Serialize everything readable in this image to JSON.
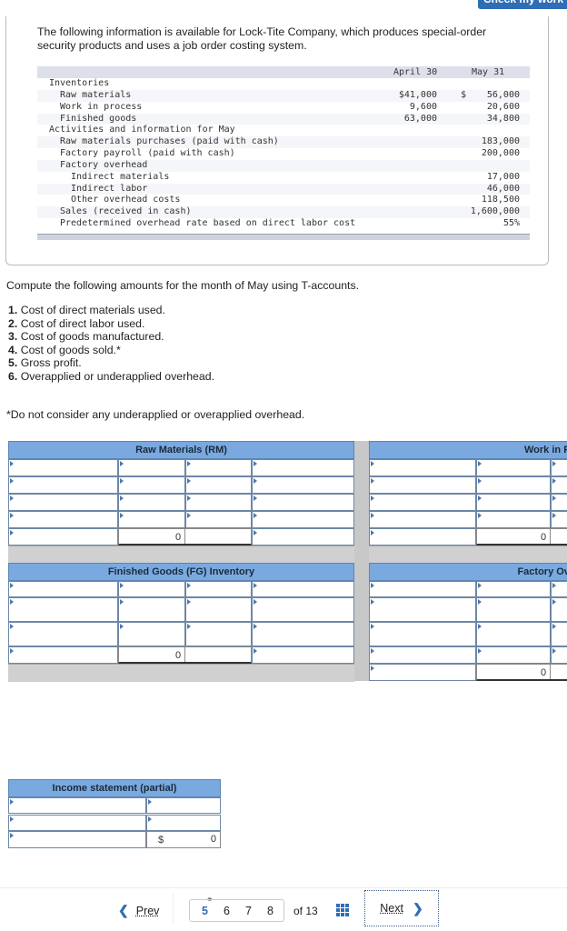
{
  "header": {
    "check_button_label": "Check my work"
  },
  "intro": "The following information is available for Lock-Tite Company, which produces special-order security products and uses a job order costing system.",
  "data_table": {
    "col_headers": [
      "April 30",
      "May 31"
    ],
    "rows": [
      {
        "label": "Inventories",
        "indent": 0,
        "april": "",
        "may_sym": "",
        "may": ""
      },
      {
        "label": "Raw materials",
        "indent": 1,
        "april": "$41,000",
        "may_sym": "$",
        "may": "56,000"
      },
      {
        "label": "Work in process",
        "indent": 1,
        "april": "9,600",
        "may_sym": "",
        "may": "20,600"
      },
      {
        "label": "Finished goods",
        "indent": 1,
        "april": "63,000",
        "may_sym": "",
        "may": "34,800"
      },
      {
        "label": "Activities and information for May",
        "indent": 0,
        "april": "",
        "may_sym": "",
        "may": ""
      },
      {
        "label": "Raw materials purchases (paid with cash)",
        "indent": 1,
        "april": "",
        "may_sym": "",
        "may": "183,000"
      },
      {
        "label": "Factory payroll (paid with cash)",
        "indent": 1,
        "april": "",
        "may_sym": "",
        "may": "200,000"
      },
      {
        "label": "Factory overhead",
        "indent": 1,
        "april": "",
        "may_sym": "",
        "may": ""
      },
      {
        "label": "Indirect materials",
        "indent": 2,
        "april": "",
        "may_sym": "",
        "may": "17,000"
      },
      {
        "label": "Indirect labor",
        "indent": 2,
        "april": "",
        "may_sym": "",
        "may": "46,000"
      },
      {
        "label": "Other overhead costs",
        "indent": 2,
        "april": "",
        "may_sym": "",
        "may": "118,500"
      },
      {
        "label": "Sales (received in cash)",
        "indent": 1,
        "april": "",
        "may_sym": "",
        "may": "1,600,000"
      },
      {
        "label": "Predetermined overhead rate based on direct labor cost",
        "indent": 1,
        "april": "",
        "may_sym": "",
        "may": "55%"
      }
    ]
  },
  "instructions": {
    "compute": "Compute the following amounts for the month of May using T-accounts.",
    "items": [
      {
        "num": "1.",
        "text": "Cost of direct materials used."
      },
      {
        "num": "2.",
        "text": "Cost of direct labor used."
      },
      {
        "num": "3.",
        "text": "Cost of goods manufactured."
      },
      {
        "num": "4.",
        "text": "Cost of goods sold.*"
      },
      {
        "num": "5.",
        "text": "Gross profit."
      },
      {
        "num": "6.",
        "text": "Overapplied or underapplied overhead."
      }
    ],
    "note": "*Do not consider any underapplied or overapplied overhead."
  },
  "t_accounts": {
    "raw_materials": {
      "title": "Raw Materials (RM)",
      "balance": "0"
    },
    "work_in_process": {
      "title": "Work in Process",
      "balance": "0"
    },
    "finished_goods": {
      "title": "Finished Goods (FG) Inventory",
      "balance": "0"
    },
    "factory_overhead": {
      "title": "Factory Overhead",
      "balance": "0"
    }
  },
  "income_statement": {
    "title": "Income statement (partial)",
    "currency": "$",
    "total": "0"
  },
  "pager": {
    "prev_label": "Prev",
    "next_label": "Next",
    "pages": [
      "5",
      "6",
      "7",
      "8"
    ],
    "current_page": "5",
    "of_label": "of 13"
  }
}
